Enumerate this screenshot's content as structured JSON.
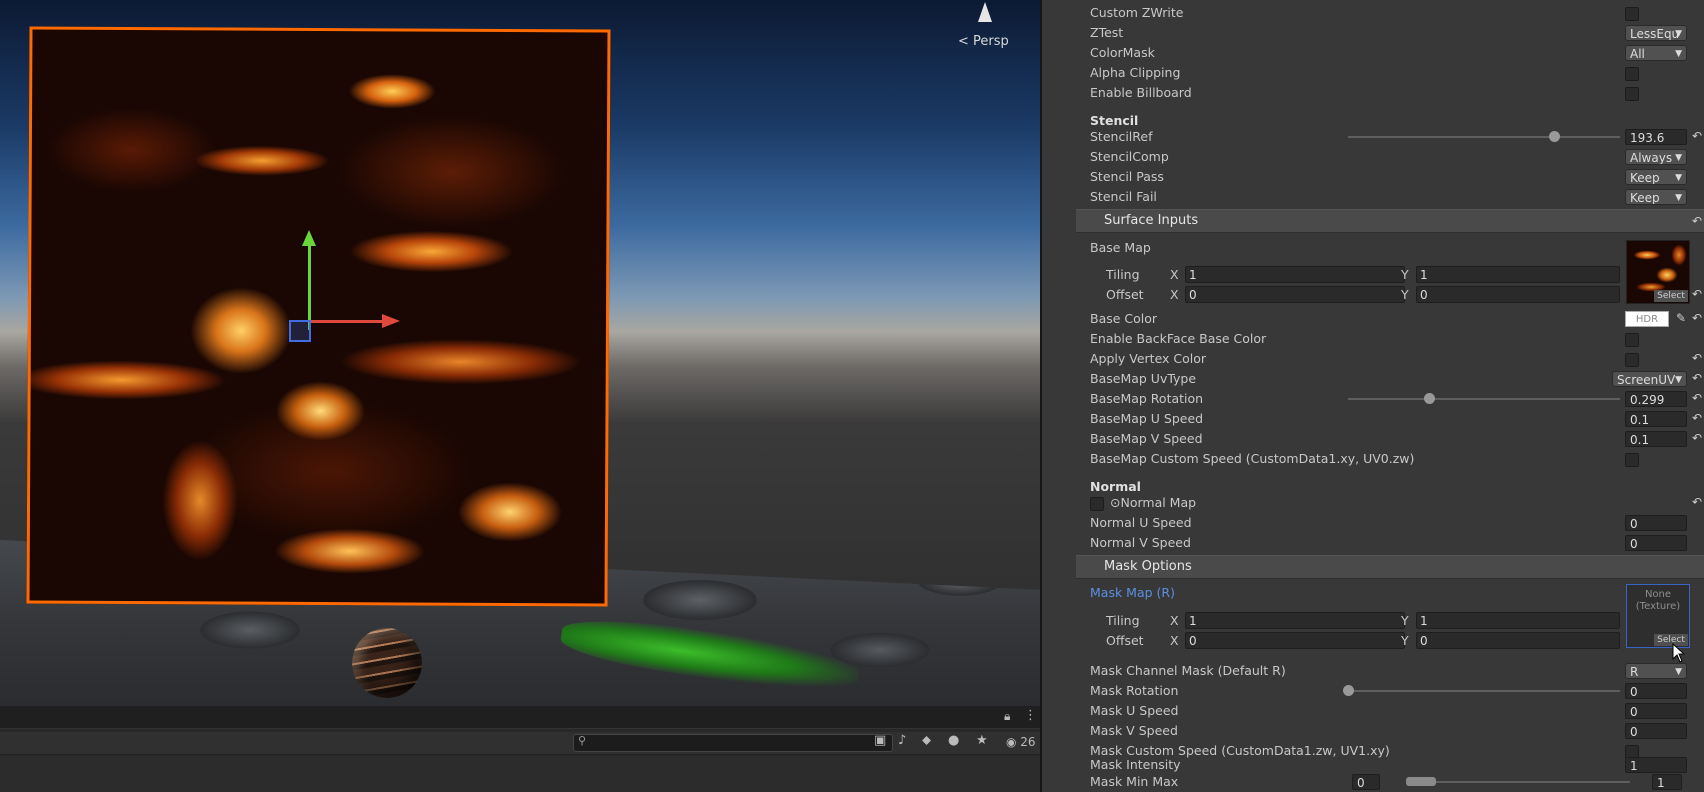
{
  "scene": {
    "view_label": "< Persp",
    "search_placeholder": "",
    "hidden_count": "26"
  },
  "inspector": {
    "rows_top": [
      {
        "label": "Custom ZWrite",
        "control": "checkbox"
      },
      {
        "label": "ZTest",
        "control": "dropdown",
        "value": "LessEqu"
      },
      {
        "label": "ColorMask",
        "control": "dropdown",
        "value": "All"
      },
      {
        "label": "Alpha Clipping",
        "control": "checkbox"
      },
      {
        "label": "Enable Billboard",
        "control": "checkbox"
      }
    ],
    "stencil": {
      "header": "Stencil",
      "stencil_ref_label": "StencilRef",
      "stencil_ref_value": "193.6",
      "stencil_ref_fraction": 0.757,
      "stencil_comp_label": "StencilComp",
      "stencil_comp_value": "Always",
      "stencil_pass_label": "Stencil Pass",
      "stencil_pass_value": "Keep",
      "stencil_fail_label": "Stencil Fail",
      "stencil_fail_value": "Keep"
    },
    "surface_inputs": {
      "title": "Surface Inputs",
      "base_map_label": "Base Map",
      "tiling_label": "Tiling",
      "offset_label": "Offset",
      "x_label": "X",
      "y_label": "Y",
      "tiling_x": "1",
      "tiling_y": "1",
      "offset_x": "0",
      "offset_y": "0",
      "select_label": "Select",
      "base_color_label": "Base Color",
      "hdr_label": "HDR",
      "enable_backface_label": "Enable BackFace Base Color",
      "apply_vertex_label": "Apply Vertex Color",
      "uvtype_label": "BaseMap UvType",
      "uvtype_value": "ScreenUV",
      "rotation_label": "BaseMap Rotation",
      "rotation_value": "0.299",
      "rotation_fraction": 0.299,
      "u_speed_label": "BaseMap U Speed",
      "u_speed_value": "0.1",
      "v_speed_label": "BaseMap V Speed",
      "v_speed_value": "0.1",
      "custom_speed_label": "BaseMap Custom Speed (CustomData1.xy, UV0.zw)"
    },
    "normal": {
      "header": "Normal",
      "normal_map_label": "⊙Normal Map",
      "u_speed_label": "Normal U Speed",
      "u_speed_value": "0",
      "v_speed_label": "Normal V Speed",
      "v_speed_value": "0"
    },
    "mask_options": {
      "title": "Mask Options",
      "mask_map_label": "Mask Map (R)",
      "tiling_label": "Tiling",
      "offset_label": "Offset",
      "x_label": "X",
      "y_label": "Y",
      "tiling_x": "1",
      "tiling_y": "1",
      "offset_x": "0",
      "offset_y": "0",
      "none_texture": "None (Texture)",
      "select_label": "Select",
      "channel_label": "Mask Channel Mask (Default R)",
      "channel_value": "R",
      "rotation_label": "Mask Rotation",
      "rotation_value": "0",
      "rotation_fraction": 0.0,
      "u_speed_label": "Mask U Speed",
      "u_speed_value": "0",
      "v_speed_label": "Mask V Speed",
      "v_speed_value": "0",
      "custom_speed_label": "Mask Custom Speed (CustomData1.zw, UV1.xy)",
      "intensity_label": "Mask Intensity",
      "intensity_value": "1",
      "minmax_label": "Mask Min Max",
      "minmax_min": "0",
      "minmax_max": "1"
    }
  },
  "colors": {
    "selection_outline": "#ff6a00",
    "gizmo_y": "#6ad63d",
    "gizmo_x": "#e04a3c",
    "gizmo_z": "#3e6ee0",
    "mask_map_label": "#5b8fe2"
  },
  "icons": [
    "persp-cone-icon",
    "lock-icon",
    "kebab-menu-icon",
    "search-icon",
    "scene-filter-icon",
    "audio-icon",
    "tag-icon",
    "error-icon",
    "star-icon",
    "eye-icon",
    "reset-icon",
    "eyedropper-icon",
    "dropdown-arrow-icon"
  ]
}
